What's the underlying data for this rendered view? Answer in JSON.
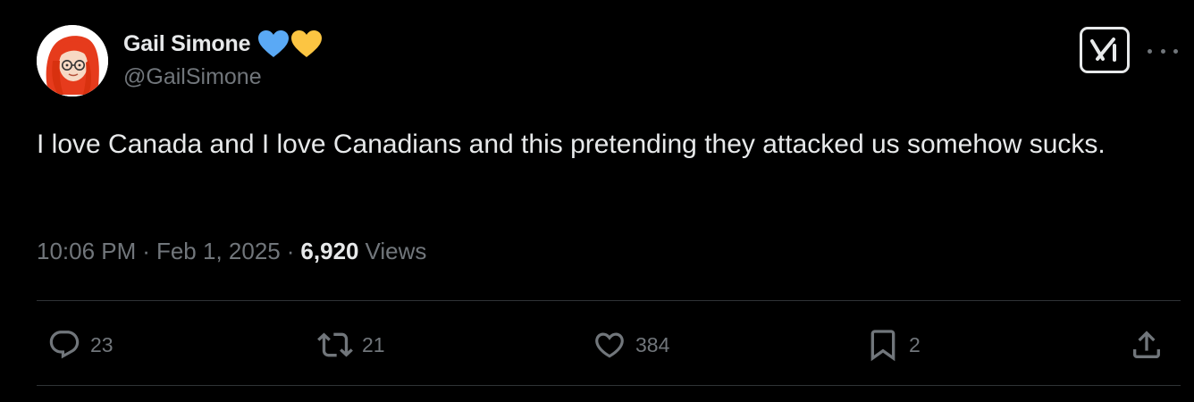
{
  "author": {
    "display_name": "Gail Simone",
    "handle": "@GailSimone",
    "badges": [
      "blue-heart-emoji",
      "yellow-heart-emoji"
    ],
    "avatar_icon": "red-haired-woman-avatar"
  },
  "header_actions": {
    "grok_icon": "grok-icon",
    "more_icon": "more-dots-icon"
  },
  "tweet": {
    "text": "I love Canada and I love Canadians and this pretending they attacked us somehow sucks."
  },
  "meta": {
    "time": "10:06 PM",
    "separator": "·",
    "date": "Feb 1, 2025",
    "views_count": "6,920",
    "views_label": "Views"
  },
  "actions": {
    "replies": "23",
    "retweets": "21",
    "likes": "384",
    "bookmarks": "2"
  },
  "colors": {
    "background": "#000000",
    "primary_text": "#e7e9ea",
    "secondary_text": "#71767b",
    "divider": "#2f3336",
    "blue_heart": "#5aa9f5",
    "yellow_heart": "#fcc542"
  }
}
